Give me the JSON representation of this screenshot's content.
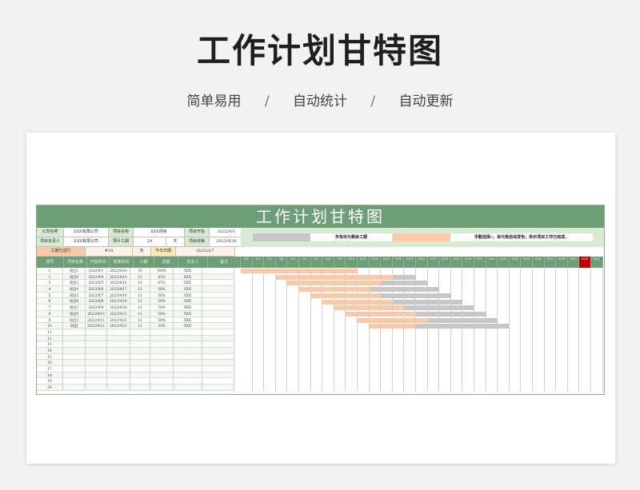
{
  "hero": {
    "title": "工作计划甘特图",
    "sub": [
      "简单易用",
      "自动统计",
      "自动更新"
    ],
    "sep": "/"
  },
  "sheet": {
    "title": "工作计划甘特图",
    "info1": [
      "公司名称",
      "XXX有限公司",
      "项目名称",
      "XXX项目",
      "项目开始",
      "2022/9/1"
    ],
    "info2": [
      "项目负责人",
      "XXX有限公司",
      "预计工期",
      "29",
      "天",
      "项目结束",
      "2022/9/30"
    ],
    "info3": [
      "工期已进行",
      "#18",
      "天",
      "今日日期",
      "2025/3/7"
    ],
    "legend_text": "灰色块为剩余工期",
    "legend_note": "手動选择√，单元格自动变色，表示项目工作已完成，",
    "colors": {
      "header": "#6e9e76",
      "done": "#f9c9a9",
      "remain": "#c7c7c7",
      "label": "#d9ead3"
    },
    "columns": [
      "序号",
      "项目名称",
      "开始时间",
      "结束时间",
      "工期",
      "进度",
      "负责人",
      "备注"
    ],
    "tasks": [
      [
        "1",
        "项目1",
        "2022/9/1",
        "2022/9/10",
        "10",
        "100%",
        "XXX",
        ""
      ],
      [
        "2",
        "项目8",
        "2022/9/4",
        "2022/9/15",
        "12",
        "83%",
        "XXX",
        ""
      ],
      [
        "3",
        "项目2",
        "2022/9/5",
        "2022/9/16",
        "12",
        "67%",
        "XXX",
        ""
      ],
      [
        "4",
        "项目4",
        "2022/9/6",
        "2022/9/17",
        "12",
        "50%",
        "XXX",
        ""
      ],
      [
        "5",
        "项目5",
        "2022/9/7",
        "2022/9/18",
        "12",
        "50%",
        "XXX",
        ""
      ],
      [
        "6",
        "项目6",
        "2022/9/8",
        "2022/9/19",
        "12",
        "50%",
        "XXX",
        ""
      ],
      [
        "7",
        "项目3",
        "2022/9/9",
        "2022/9/20",
        "12",
        "50%",
        "XXX",
        ""
      ],
      [
        "8",
        "项目9",
        "2022/9/10",
        "2022/9/21",
        "12",
        "50%",
        "XXX",
        ""
      ],
      [
        "9",
        "项目3",
        "2022/9/11",
        "2022/9/22",
        "12",
        "50%",
        "XXX",
        ""
      ],
      [
        "10",
        "项目J",
        "2022/9/12",
        "2022/9/23",
        "12",
        "33%",
        "XXX",
        ""
      ],
      [
        "11",
        "",
        "",
        "",
        "",
        "",
        "",
        ""
      ],
      [
        "12",
        "",
        "",
        "",
        "",
        "",
        "",
        ""
      ],
      [
        "13",
        "",
        "",
        "",
        "",
        "",
        "",
        ""
      ],
      [
        "14",
        "",
        "",
        "",
        "",
        "",
        "",
        ""
      ],
      [
        "15",
        "",
        "",
        "",
        "",
        "",
        "",
        ""
      ],
      [
        "16",
        "",
        "",
        "",
        "",
        "",
        "",
        ""
      ],
      [
        "17",
        "",
        "",
        "",
        "",
        "",
        "",
        ""
      ],
      [
        "18",
        "",
        "",
        "",
        "",
        "",
        "",
        ""
      ],
      [
        "19",
        "",
        "",
        "",
        "",
        "",
        "",
        ""
      ],
      [
        "20",
        "",
        "",
        "",
        "",
        "",
        "",
        ""
      ]
    ],
    "gantt_days": [
      "9/1",
      "9/2",
      "9/3",
      "9/4",
      "9/5",
      "9/6",
      "9/7",
      "9/8",
      "9/9",
      "9/10",
      "9/11",
      "9/12",
      "9/13",
      "9/14",
      "9/15",
      "9/16",
      "9/17",
      "9/18",
      "9/19",
      "9/20",
      "9/21",
      "9/22",
      "9/23",
      "9/24",
      "9/25",
      "9/26",
      "9/27",
      "9/28",
      "9/29",
      "9/30",
      "10/1"
    ],
    "today_index": 29,
    "bars": [
      {
        "start": 0,
        "done": 10,
        "remain": 0
      },
      {
        "start": 3,
        "done": 10,
        "remain": 2
      },
      {
        "start": 4,
        "done": 8,
        "remain": 4
      },
      {
        "start": 5,
        "done": 6,
        "remain": 6
      },
      {
        "start": 6,
        "done": 6,
        "remain": 6
      },
      {
        "start": 7,
        "done": 6,
        "remain": 6
      },
      {
        "start": 8,
        "done": 6,
        "remain": 6
      },
      {
        "start": 9,
        "done": 6,
        "remain": 6
      },
      {
        "start": 10,
        "done": 6,
        "remain": 6
      },
      {
        "start": 11,
        "done": 4,
        "remain": 8
      }
    ]
  }
}
